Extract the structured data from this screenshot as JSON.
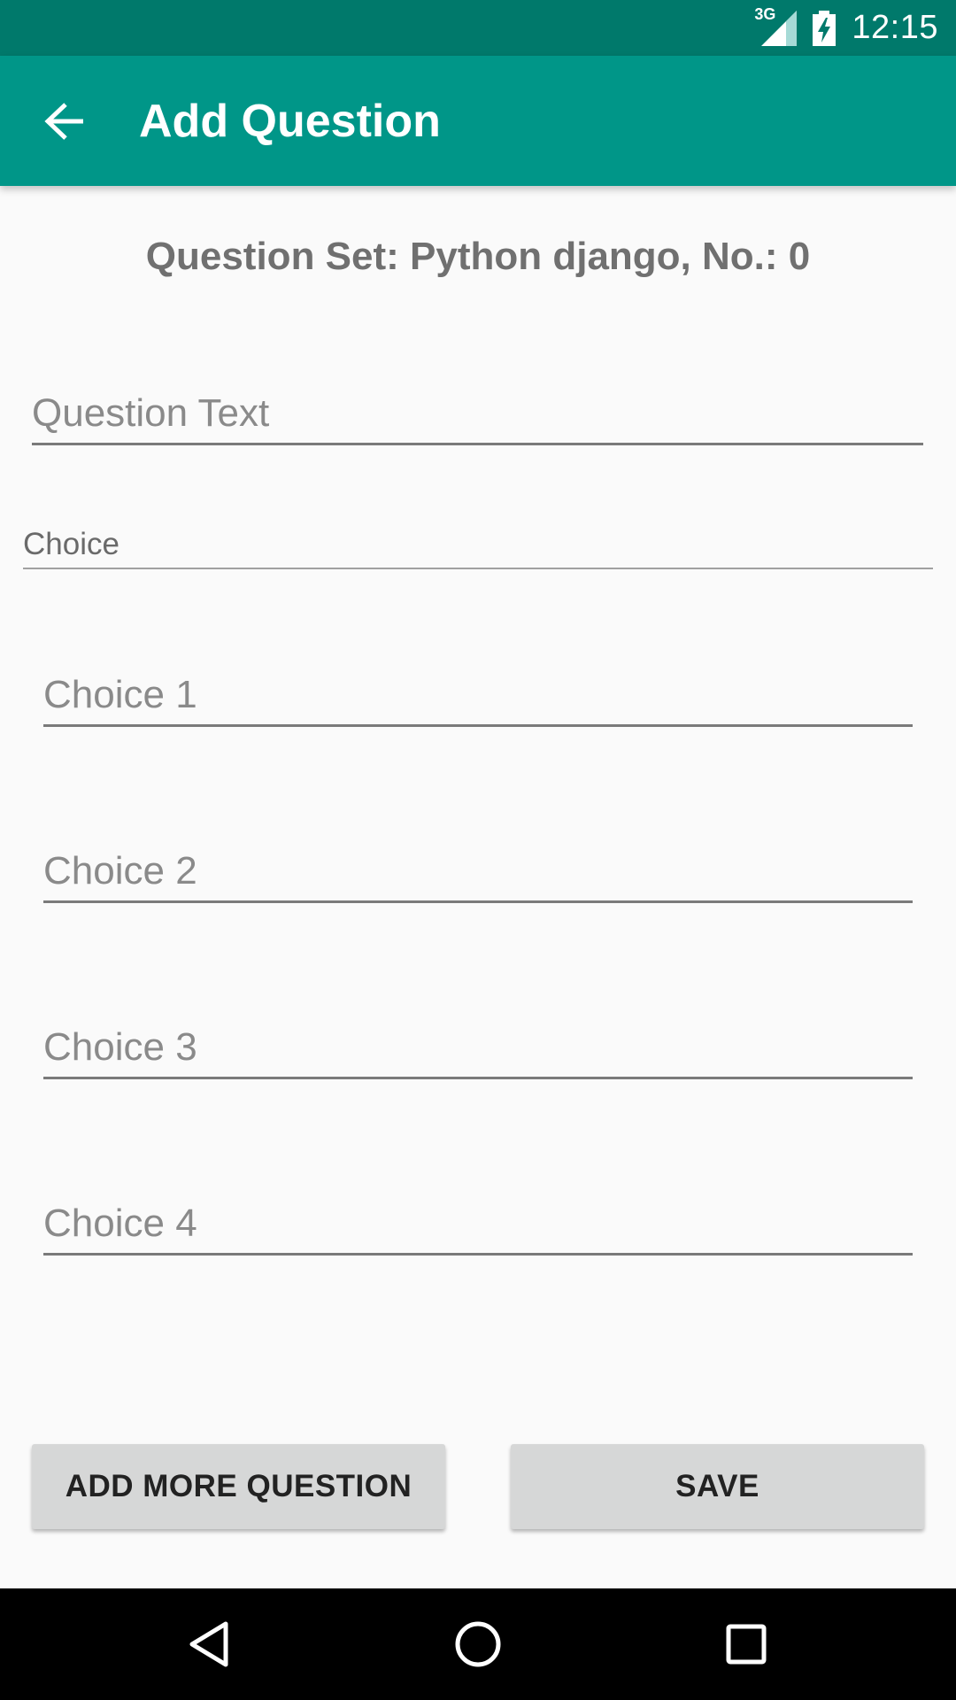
{
  "status_bar": {
    "time": "12:15",
    "network_label": "3G",
    "icons": [
      "network-3g-icon",
      "signal-icon",
      "battery-charging-icon"
    ]
  },
  "app_bar": {
    "title": "Add Question",
    "back_icon": "arrow-back-icon",
    "color": "#009688",
    "status_color": "#00796b"
  },
  "question_set_header": "Question Set: Python django, No.: 0",
  "question_field": {
    "placeholder": "Question Text",
    "value": ""
  },
  "choice_section_label": "Choice",
  "choices": [
    {
      "placeholder": "Choice 1",
      "value": ""
    },
    {
      "placeholder": "Choice 2",
      "value": ""
    },
    {
      "placeholder": "Choice 3",
      "value": ""
    },
    {
      "placeholder": "Choice 4",
      "value": ""
    }
  ],
  "buttons": {
    "add_more": "ADD MORE QUESTION",
    "save": "SAVE"
  },
  "nav_bar": {
    "icons": [
      "back-triangle-icon",
      "home-circle-icon",
      "recents-square-icon"
    ]
  }
}
